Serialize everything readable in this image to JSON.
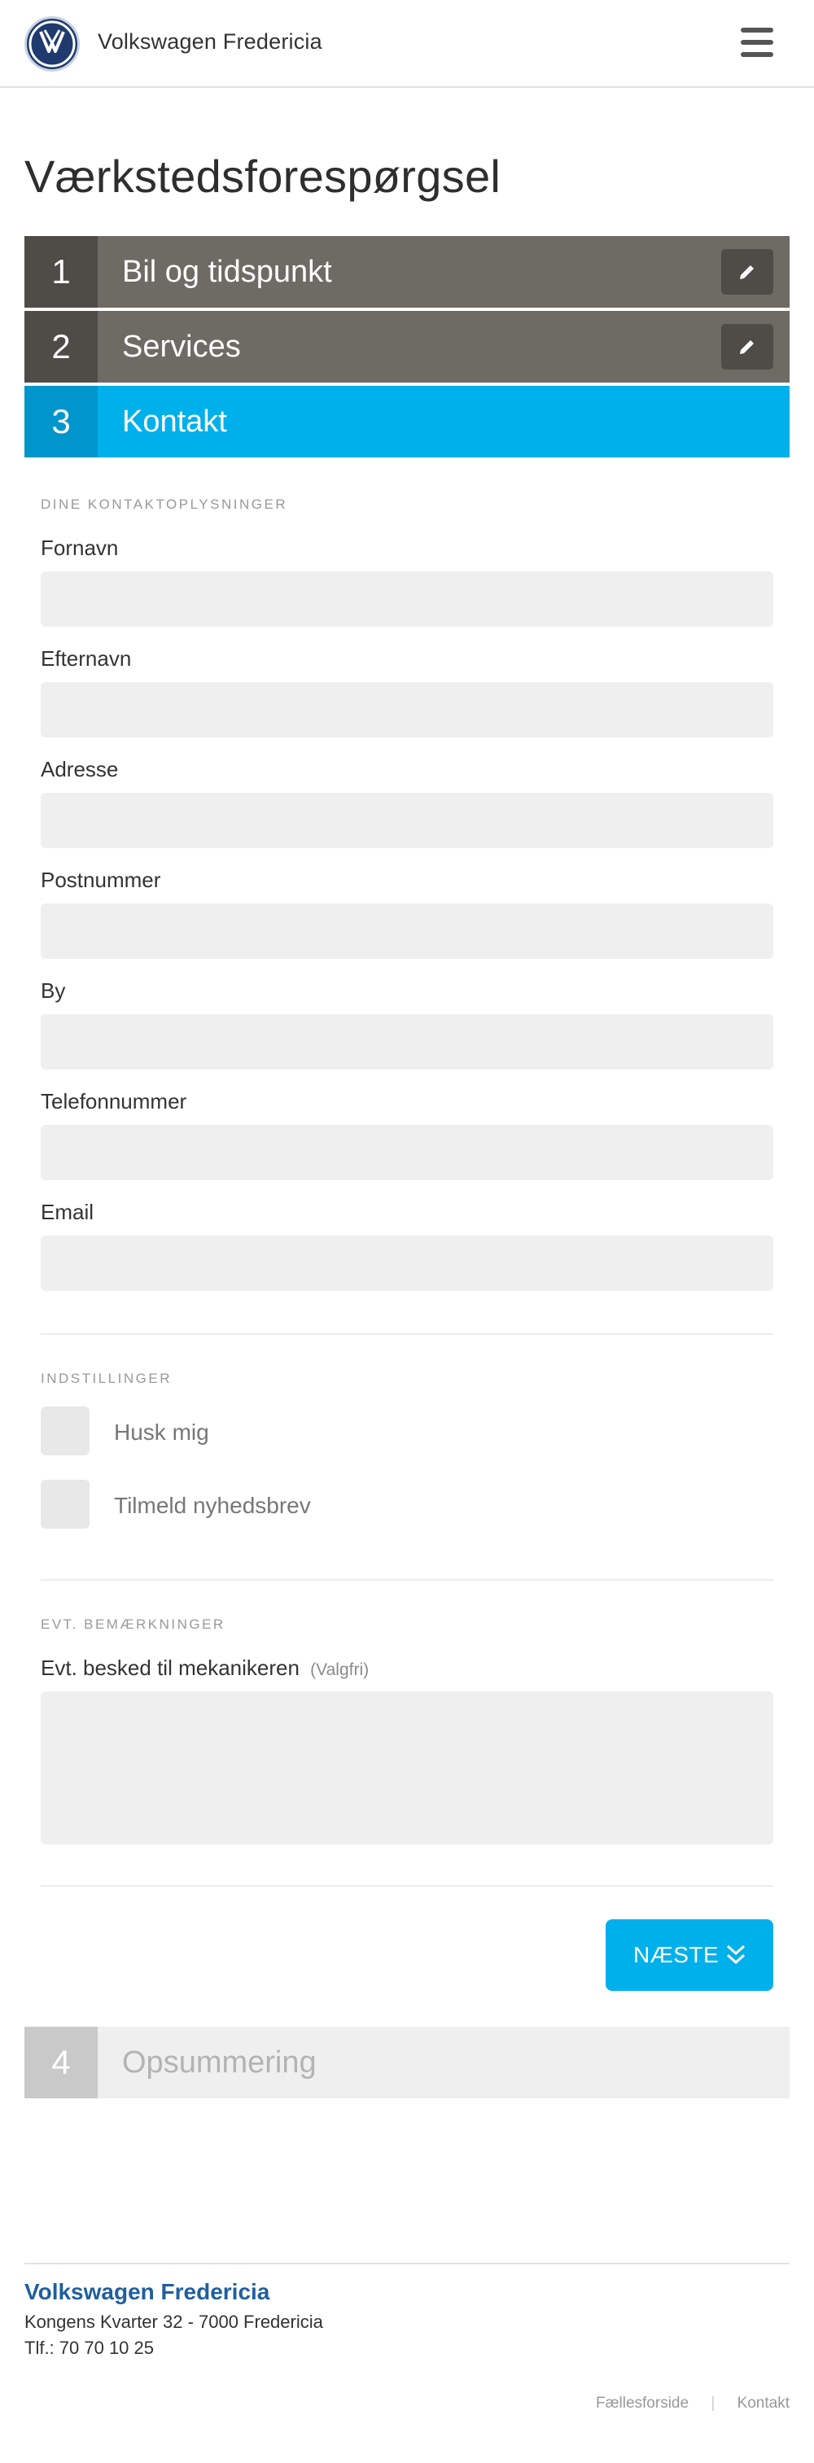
{
  "header": {
    "brand": "Volkswagen Fredericia",
    "logo_icon": "vw-logo",
    "menu_icon": "hamburger-menu-icon"
  },
  "page_title": "Værkstedsforespørgsel",
  "steps": [
    {
      "number": "1",
      "label": "Bil og tidspunkt",
      "state": "done"
    },
    {
      "number": "2",
      "label": "Services",
      "state": "done"
    },
    {
      "number": "3",
      "label": "Kontakt",
      "state": "active"
    },
    {
      "number": "4",
      "label": "Opsummering",
      "state": "pending"
    }
  ],
  "contact": {
    "section_label": "DINE KONTAKTOPLYSNINGER",
    "fields": [
      {
        "label": "Fornavn",
        "value": ""
      },
      {
        "label": "Efternavn",
        "value": ""
      },
      {
        "label": "Adresse",
        "value": ""
      },
      {
        "label": "Postnummer",
        "value": ""
      },
      {
        "label": "By",
        "value": ""
      },
      {
        "label": "Telefonnummer",
        "value": ""
      },
      {
        "label": "Email",
        "value": ""
      }
    ]
  },
  "settings": {
    "section_label": "INDSTILLINGER",
    "options": [
      {
        "label": "Husk mig",
        "checked": false
      },
      {
        "label": "Tilmeld nyhedsbrev",
        "checked": false
      }
    ]
  },
  "remarks": {
    "section_label": "EVT. BEMÆRKNINGER",
    "label": "Evt. besked til mekanikeren",
    "optional": "(Valgfri)",
    "value": ""
  },
  "next_button": {
    "label": "NÆSTE",
    "icon": "double-chevron-down-icon"
  },
  "footer": {
    "name": "Volkswagen Fredericia",
    "address": "Kongens Kvarter 32 - 7000 Fredericia",
    "phone": "Tlf.: 70 70 10 25",
    "links": [
      "Fællesforside",
      "Kontakt"
    ]
  },
  "colors": {
    "accent": "#00b0eb",
    "step_done": "#6e6a64",
    "footer_name": "#1f5f9f"
  }
}
